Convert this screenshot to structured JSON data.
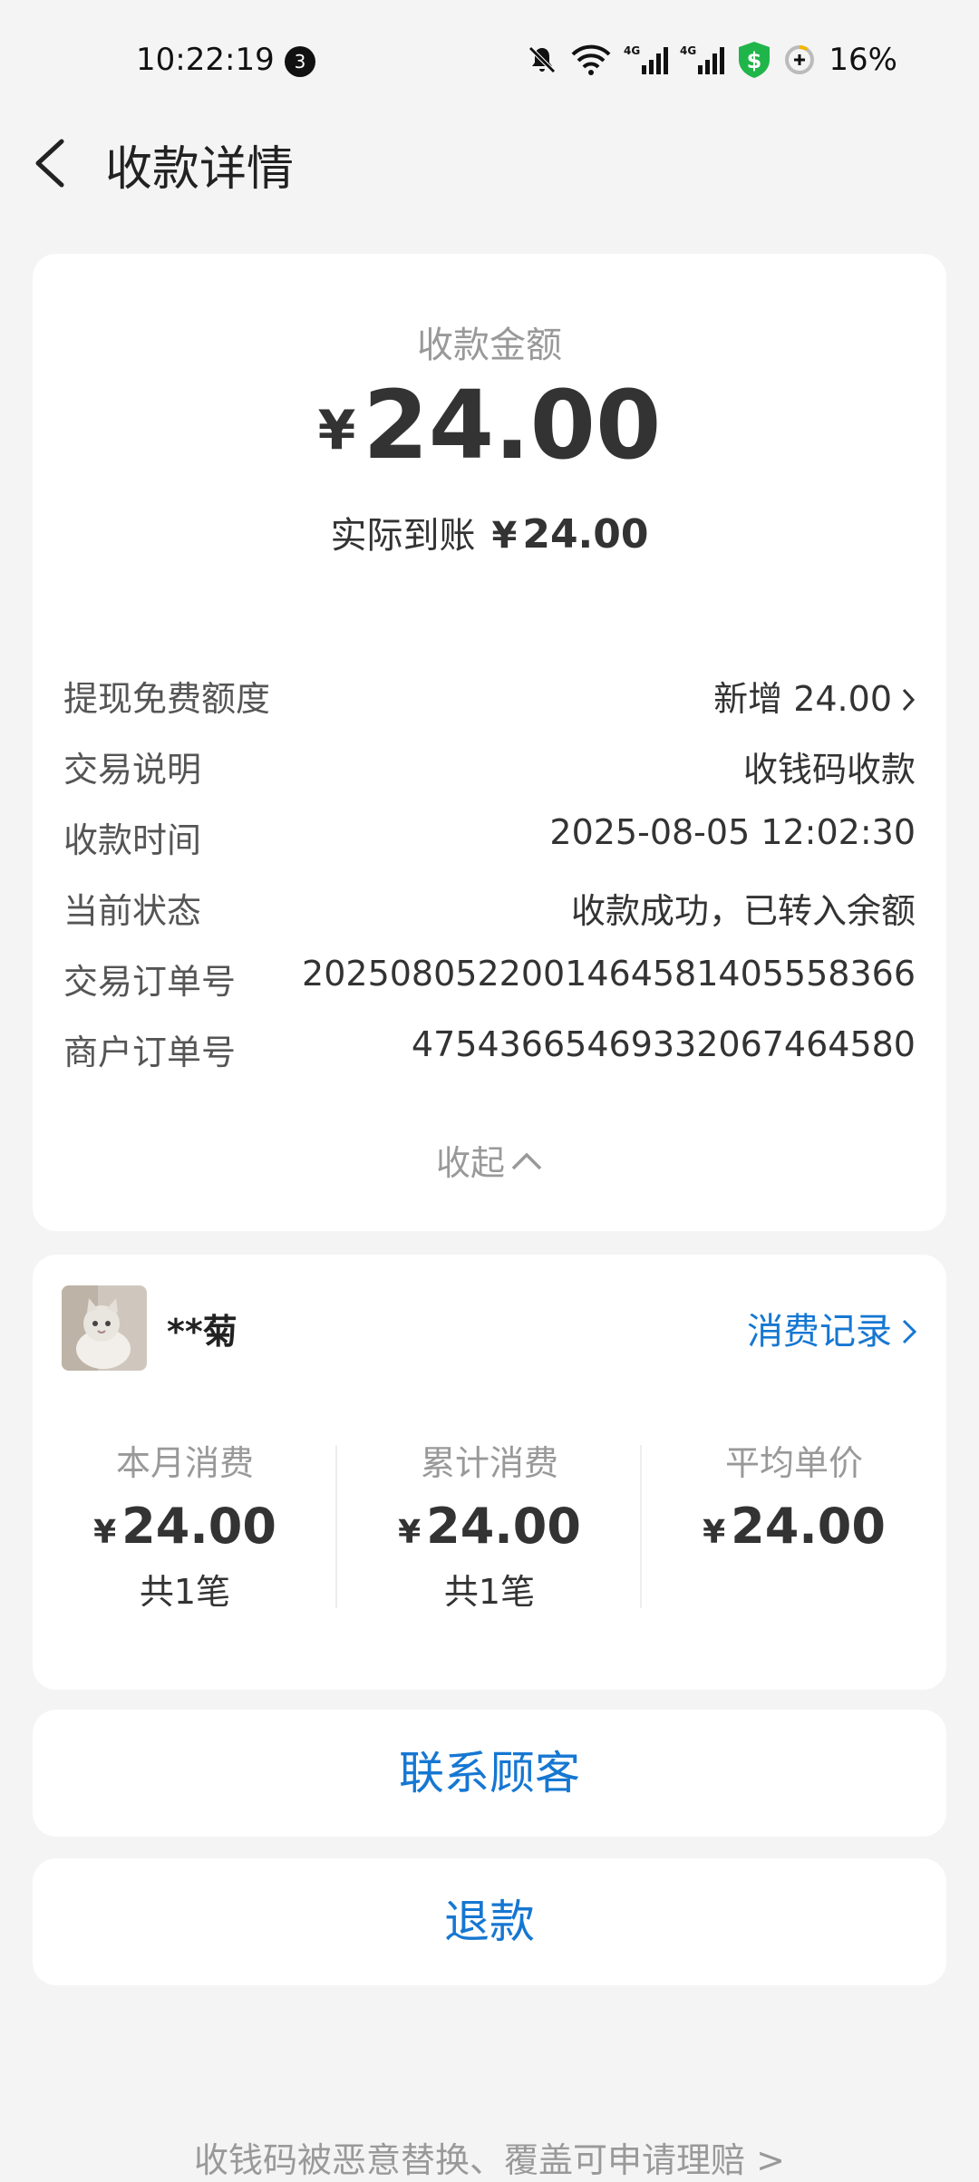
{
  "status_bar": {
    "time": "10:22:19",
    "notification_count": "3",
    "network_1": "4G",
    "network_2": "4G",
    "battery_percent": "16%"
  },
  "header": {
    "title": "收款详情"
  },
  "amount": {
    "label": "收款金额",
    "currency": "¥",
    "value": "24.00",
    "received_label": "实际到账",
    "received_value": "24.00"
  },
  "details": [
    {
      "label": "提现免费额度",
      "value": "新增 24.00"
    },
    {
      "label": "交易说明",
      "value": "收钱码收款"
    },
    {
      "label": "收款时间",
      "value": "2025-08-05 12:02:30"
    },
    {
      "label": "当前状态",
      "value": "收款成功，已转入余额"
    },
    {
      "label": "交易订单号",
      "value": "2025080522001464581405558366"
    },
    {
      "label": "商户订单号",
      "value": "4754366546933206746​4580"
    }
  ],
  "collapse_label": "收起",
  "customer": {
    "name": "**菊",
    "records_link": "消费记录",
    "stats": [
      {
        "label": "本月消费",
        "value": "24.00",
        "count": "共1笔"
      },
      {
        "label": "累计消费",
        "value": "24.00",
        "count": "共1笔"
      },
      {
        "label": "平均单价",
        "value": "24.00",
        "count": ""
      }
    ]
  },
  "actions": {
    "contact": "联系顾客",
    "refund": "退款"
  },
  "footer_link": "收钱码被恶意替换、覆盖可申请理赔 >",
  "colors": {
    "accent": "#1677d2",
    "background": "#f4f4f4",
    "shield": "#20b54a"
  }
}
